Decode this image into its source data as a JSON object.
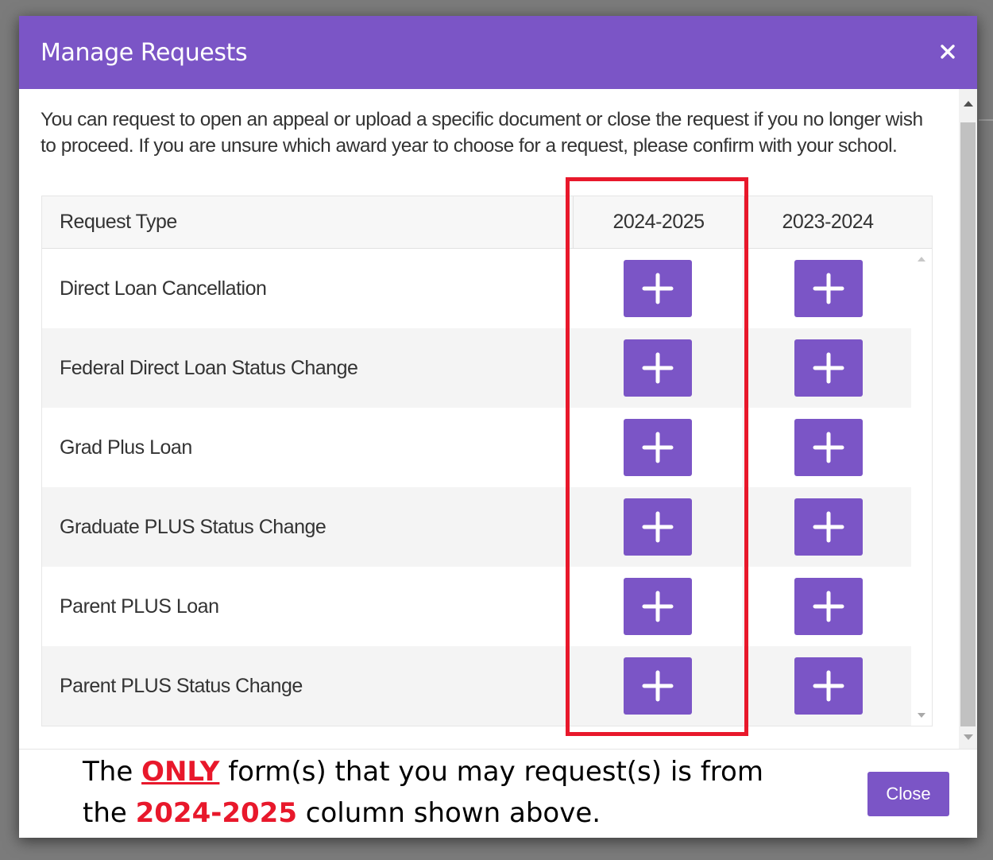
{
  "modal": {
    "title": "Manage Requests",
    "close_icon": "close-icon"
  },
  "intro": "You can request to open an appeal or upload a specific document or close the request if you no longer wish to proceed. If you are unsure which award year to choose for a request, please confirm with your school.",
  "table": {
    "headers": [
      "Request Type",
      "2024-2025",
      "2023-2024"
    ],
    "rows": [
      {
        "label": "Direct Loan Cancellation"
      },
      {
        "label": "Federal Direct Loan Status Change"
      },
      {
        "label": "Grad Plus Loan"
      },
      {
        "label": "Graduate PLUS Status Change"
      },
      {
        "label": "Parent PLUS Loan"
      },
      {
        "label": "Parent PLUS Status Change"
      }
    ],
    "add_button_icon": "plus-icon"
  },
  "footer": {
    "note_line1_pre": "The ",
    "note_only": "ONLY",
    "note_line1_post": " form(s) that you may request(s) is from",
    "note_line2_pre": "the ",
    "note_year": "2024-2025",
    "note_line2_post": " column shown above.",
    "close_label": "Close"
  },
  "colors": {
    "accent": "#7b55c6",
    "highlight": "#e8182b"
  }
}
